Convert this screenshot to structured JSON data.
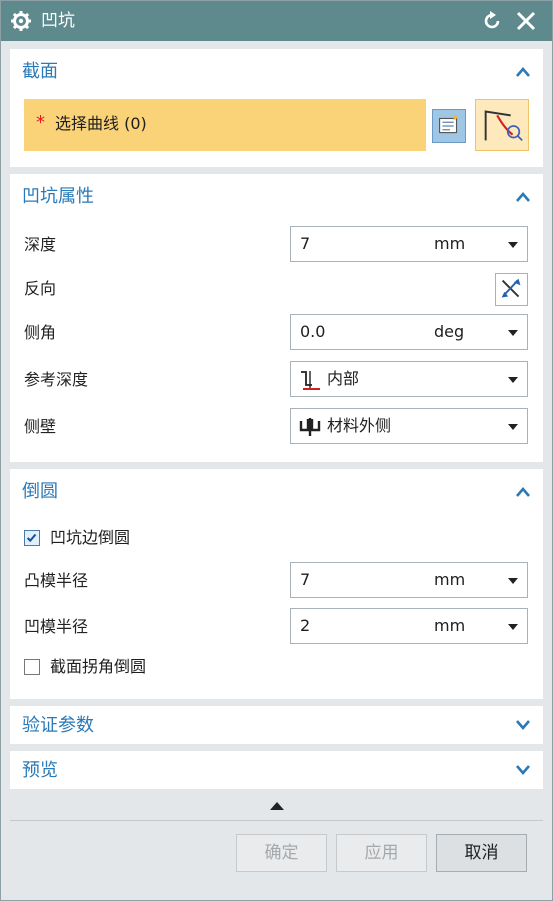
{
  "window": {
    "title": "凹坑",
    "icon": "gear-icon"
  },
  "sections": {
    "section": {
      "title": "截面",
      "select_curve_required": "*",
      "select_curve_label": "选择曲线 (0)"
    },
    "props": {
      "title": "凹坑属性",
      "depth_label": "深度",
      "depth_value": "7",
      "depth_unit": "mm",
      "reverse_label": "反向",
      "angle_label": "侧角",
      "angle_value": "0.0",
      "angle_unit": "deg",
      "ref_depth_label": "参考深度",
      "ref_depth_value": "内部",
      "side_wall_label": "侧壁",
      "side_wall_value": "材料外侧"
    },
    "fillet": {
      "title": "倒圆",
      "edge_fillet_label": "凹坑边倒圆",
      "edge_fillet_checked": true,
      "punch_radius_label": "凸模半径",
      "punch_radius_value": "7",
      "punch_radius_unit": "mm",
      "die_radius_label": "凹模半径",
      "die_radius_value": "2",
      "die_radius_unit": "mm",
      "corner_fillet_label": "截面拐角倒圆",
      "corner_fillet_checked": false
    },
    "verify": {
      "title": "验证参数"
    },
    "preview": {
      "title": "预览"
    }
  },
  "buttons": {
    "ok": "确定",
    "apply": "应用",
    "cancel": "取消"
  },
  "colors": {
    "titlebar": "#5e8a8e",
    "section_title": "#2a7ab8",
    "selection_highlight": "#fad277",
    "required_star": "#e01d1d"
  }
}
